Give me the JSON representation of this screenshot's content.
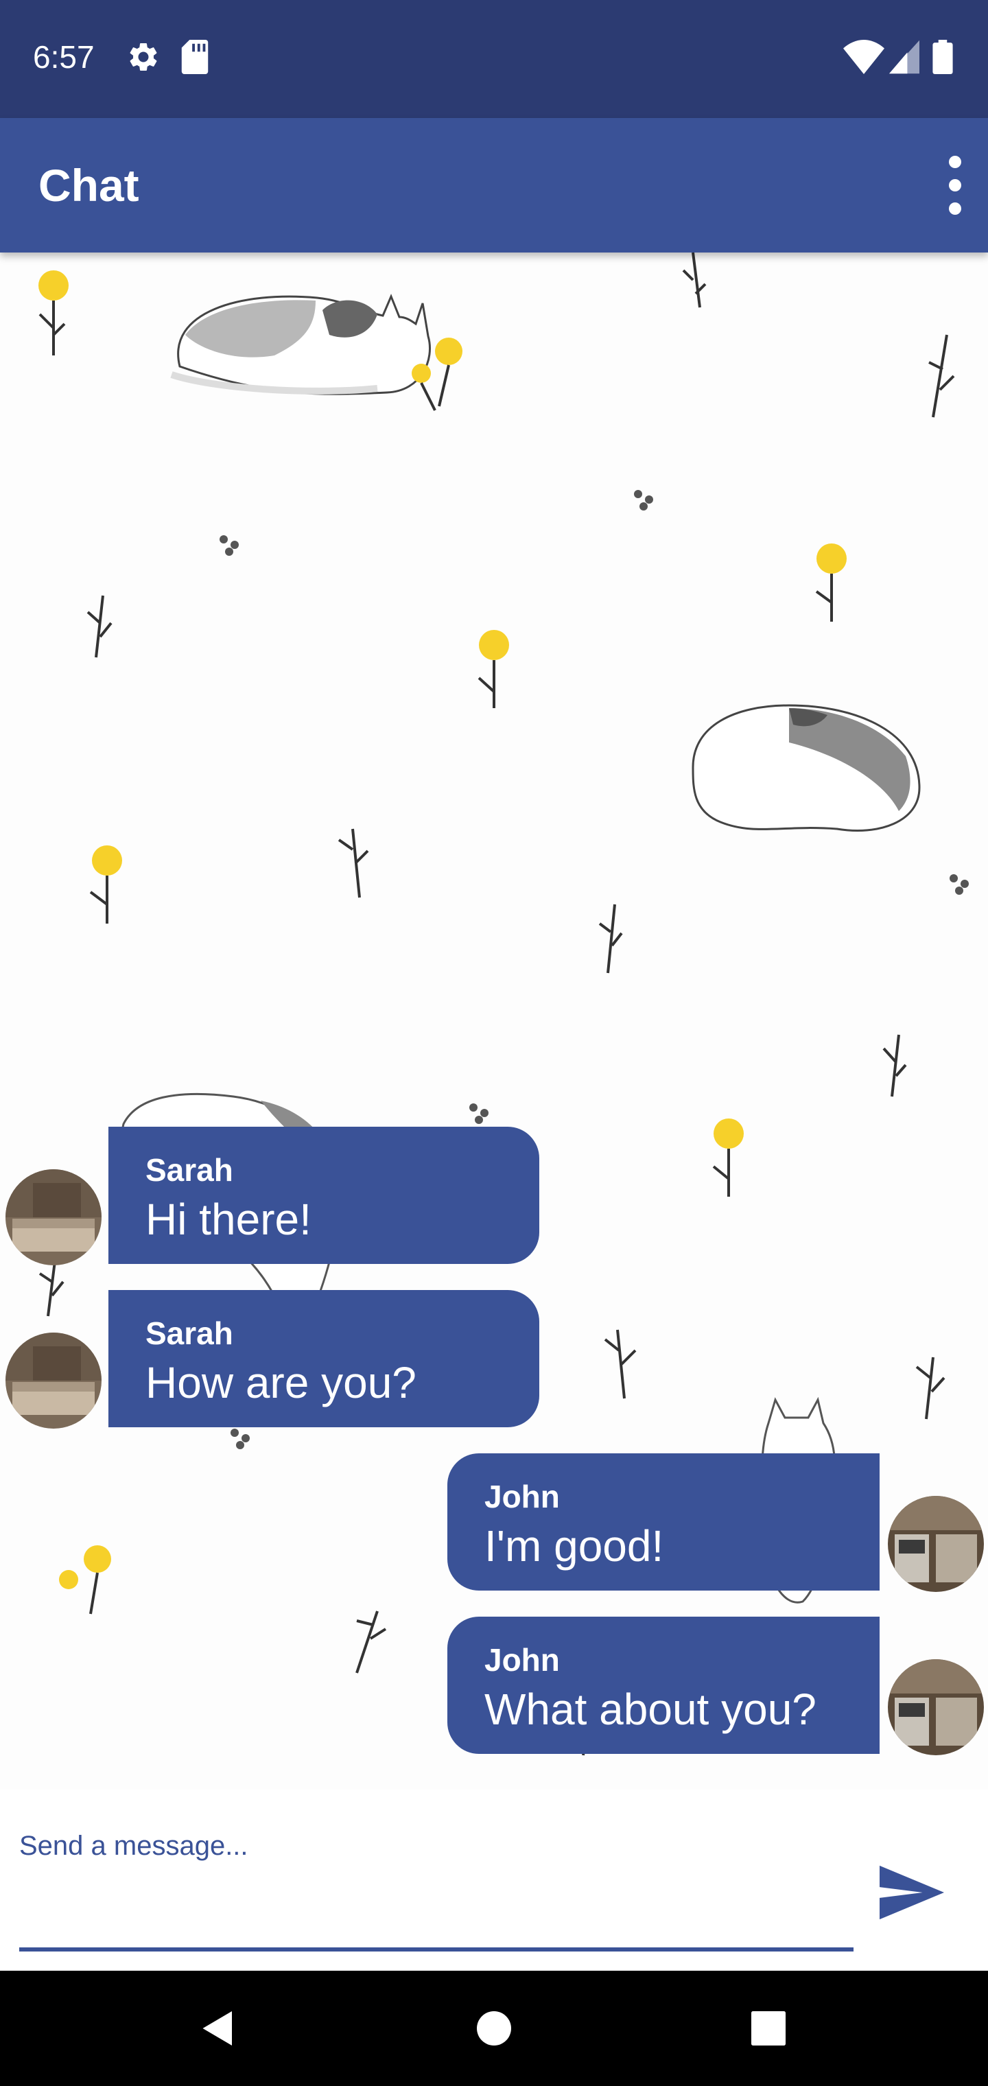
{
  "status_bar": {
    "time": "6:57"
  },
  "app_bar": {
    "title": "Chat"
  },
  "messages": [
    {
      "sender": "Sarah",
      "text": "Hi there!",
      "side": "left"
    },
    {
      "sender": "Sarah",
      "text": "How are you?",
      "side": "left"
    },
    {
      "sender": "John",
      "text": "I'm good!",
      "side": "right"
    },
    {
      "sender": "John",
      "text": "What about you?",
      "side": "right"
    }
  ],
  "composer": {
    "placeholder": "Send a message..."
  },
  "colors": {
    "status_bar": "#2c3b72",
    "app_bar": "#3a5297",
    "bubble": "#3a5297",
    "accent": "#3a5297"
  },
  "icons": {
    "status": [
      "gear-icon",
      "sd-card-icon",
      "wifi-icon",
      "signal-icon",
      "battery-icon"
    ],
    "app_bar": "more-vert-icon",
    "composer": "send-icon",
    "navigation": [
      "back-icon",
      "home-icon",
      "recents-icon"
    ]
  }
}
